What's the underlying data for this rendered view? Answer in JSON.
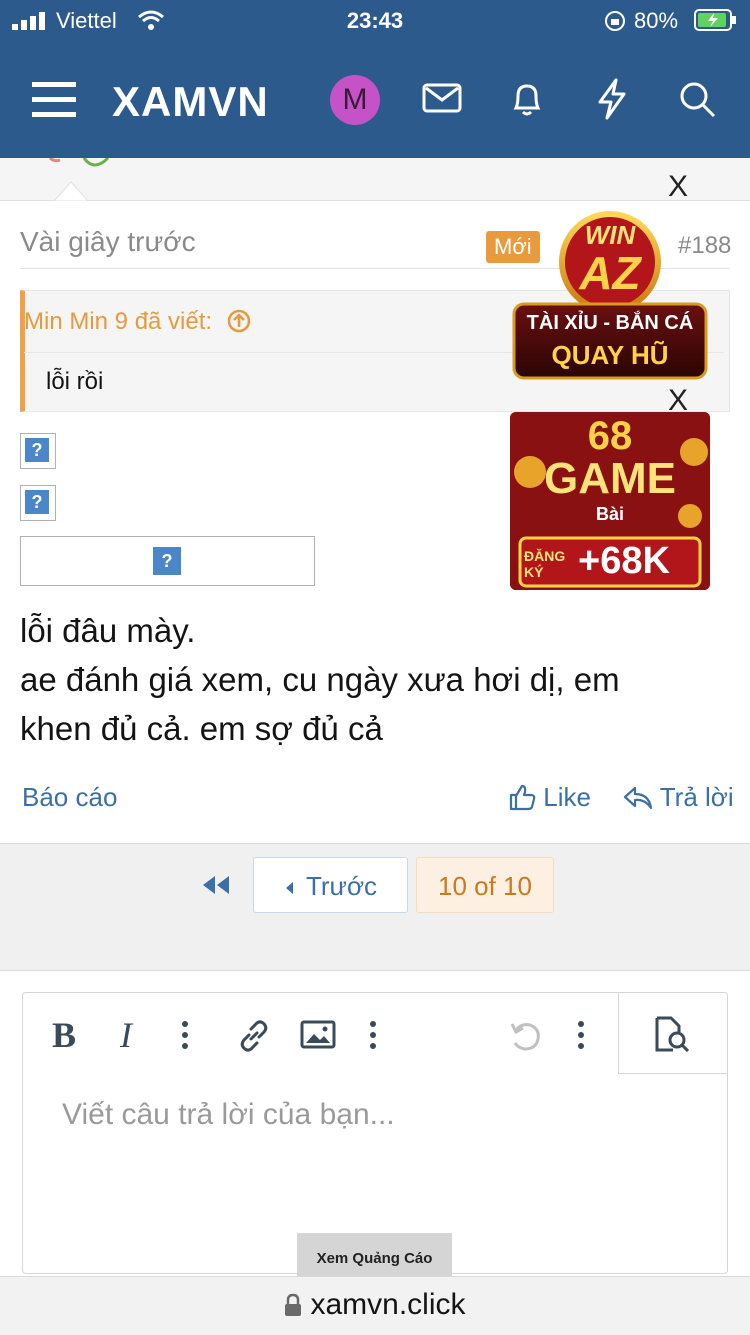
{
  "status": {
    "carrier": "Viettel",
    "time": "23:43",
    "battery": "80%"
  },
  "header": {
    "logo": "XAMVN",
    "avatar_letter": "M"
  },
  "post": {
    "time": "Vài giây trước",
    "badge": "Mới",
    "number": "#188",
    "quote_author": "Min Min 9 đã viết:",
    "quote_text": "lỗi rồi",
    "body_lines": [
      "lỗi đâu mày.",
      "ae đánh giá xem, cu ngày xưa hơi dị, em",
      "khen đủ cả. em sợ đủ cả"
    ],
    "report": "Báo cáo",
    "like": "Like",
    "reply": "Trả lời"
  },
  "broken_image_glyph": "?",
  "pagination": {
    "prev": "Trước",
    "current": "10 of 10"
  },
  "editor": {
    "placeholder": "Viết câu trả lời của bạn..."
  },
  "ads": {
    "close": "X",
    "ad1_lines": [
      "WIN",
      "AZ",
      "TÀI XỈU - BẮN CÁ",
      "QUAY HŨ"
    ],
    "ad2_lines": [
      "68",
      "GAME",
      "Bài",
      "ĐĂNG KÝ",
      "+68K"
    ],
    "view_ads": "Xem Quảng Cáo"
  },
  "urlbar": {
    "url": "xamvn.click"
  }
}
